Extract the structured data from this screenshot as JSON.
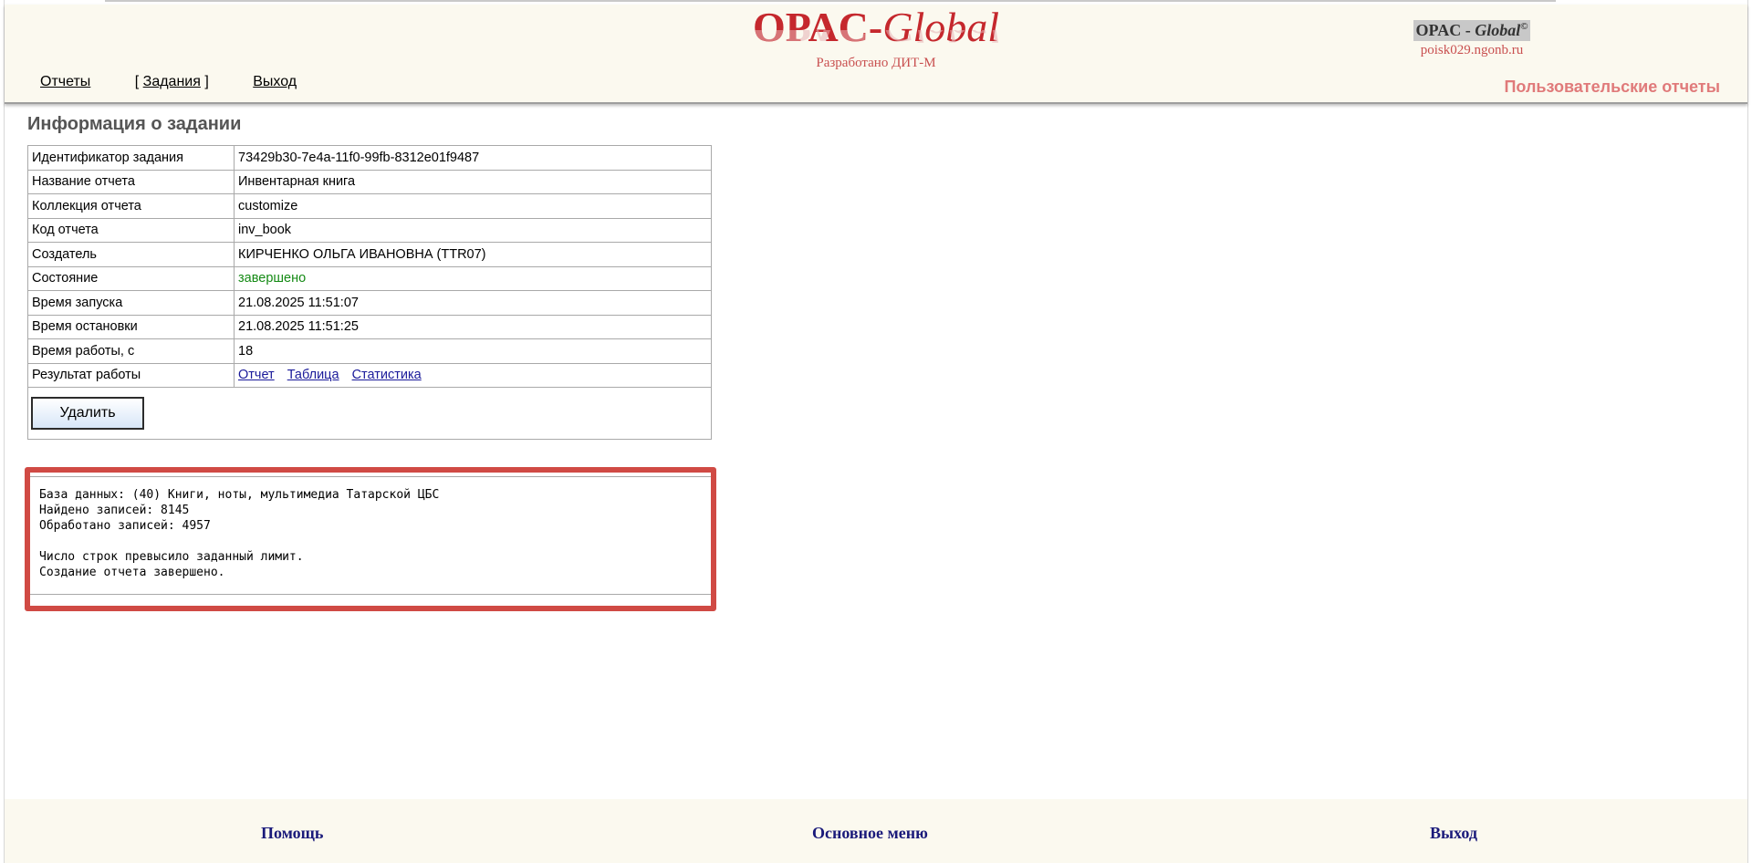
{
  "header": {
    "logo": {
      "opac": "OPAC-",
      "global": "Global"
    },
    "developer": "Разработано ДИТ-М",
    "nav": [
      {
        "label": "Отчеты"
      },
      {
        "label": "Задания",
        "open": "[ ",
        "close": " ]"
      },
      {
        "label": "Выход"
      }
    ],
    "brand": {
      "opac": "OPAC - ",
      "global": "Global",
      "copy": "©",
      "host": "poisk029.ngonb.ru"
    },
    "section_title": "Пользовательские отчеты"
  },
  "task": {
    "title": "Информация о задании",
    "rows": [
      {
        "key": "Идентификатор задания",
        "value": "73429b30-7e4a-11f0-99fb-8312e01f9487"
      },
      {
        "key": "Название отчета",
        "value": "Инвентарная книга"
      },
      {
        "key": "Коллекция отчета",
        "value": "customize"
      },
      {
        "key": "Код отчета",
        "value": "inv_book"
      },
      {
        "key": "Создатель",
        "value": "КИРЧЕНКО ОЛЬГА ИВАНОВНА (TTR07)"
      },
      {
        "key": "Состояние",
        "value": "завершено"
      },
      {
        "key": "Время запуска",
        "value": "21.08.2025 11:51:07"
      },
      {
        "key": "Время остановки",
        "value": "21.08.2025 11:51:25"
      },
      {
        "key": "Время работы, с",
        "value": "18"
      }
    ],
    "result": {
      "key": "Результат работы",
      "links": [
        "Отчет",
        "Таблица",
        "Статистика"
      ]
    },
    "delete_label": "Удалить",
    "status_color": "#148a14"
  },
  "log": {
    "lines": [
      "База данных: (40) Книги, ноты, мультимедиа Татарской ЦБС",
      "Найдено записей: 8145",
      "Обработано записей: 4957",
      "",
      "Число строк превысило заданный лимит.",
      "Создание отчета завершено."
    ],
    "highlight_color": "#d04a44"
  },
  "footer": {
    "help": "Помощь",
    "main_menu": "Основное меню",
    "exit": "Выход"
  },
  "colors": {
    "header_bg": "#fbf9ef",
    "logo_red": "#c5282d",
    "accent_pink": "#e07a7a",
    "footer_link": "#1a1a7a"
  }
}
